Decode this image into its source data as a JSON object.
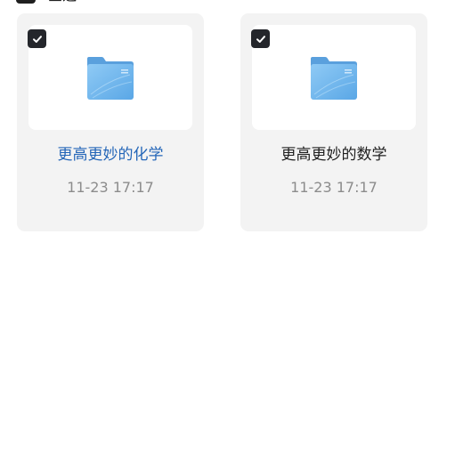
{
  "header": {
    "label": "全选"
  },
  "files": [
    {
      "name": "更高更妙的化学",
      "time": "11-23 17:17",
      "selected": true,
      "icon": "folder-icon"
    },
    {
      "name": "更高更妙的数学",
      "time": "11-23 17:17",
      "selected": true,
      "icon": "folder-icon"
    }
  ],
  "colors": {
    "card_bg": "#f3f3f3",
    "checkbox": "#24262b",
    "active_name": "#2466b8",
    "time_text": "#8c8c8c"
  }
}
